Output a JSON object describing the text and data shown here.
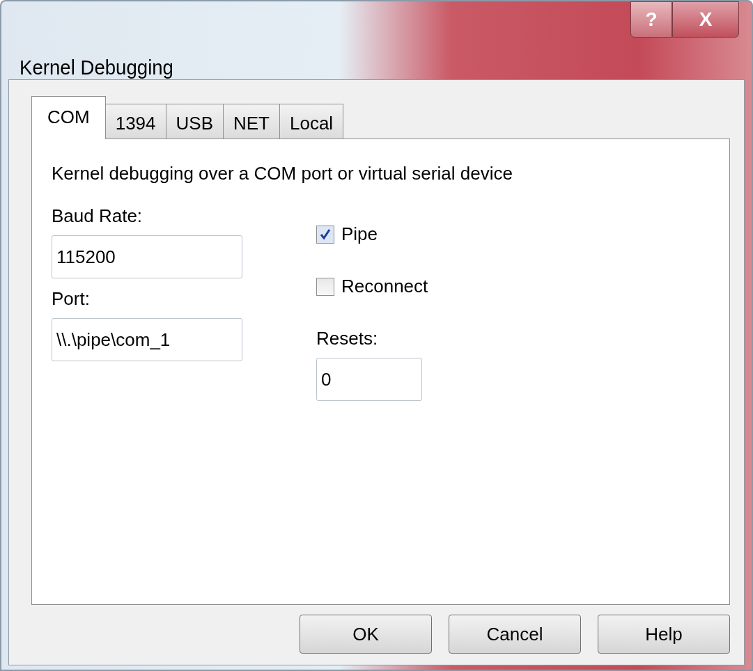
{
  "window": {
    "title": "Kernel Debugging",
    "title_buttons": [
      "?",
      "X"
    ]
  },
  "tabs": [
    {
      "label": "COM",
      "selected": true
    },
    {
      "label": "1394",
      "selected": false
    },
    {
      "label": "USB",
      "selected": false
    },
    {
      "label": "NET",
      "selected": false
    },
    {
      "label": "Local",
      "selected": false
    }
  ],
  "description": "Kernel debugging over a COM port or virtual serial device",
  "baud_rate": {
    "label": "Baud Rate:",
    "value": "115200"
  },
  "port": {
    "label": "Port:",
    "value": "\\\\.\\pipe\\com_1"
  },
  "options": [
    {
      "label": "Pipe",
      "checked": true
    },
    {
      "label": "Reconnect",
      "checked": false
    }
  ],
  "resets": {
    "label": "Resets:",
    "value": "0"
  },
  "buttons": [
    "OK",
    "Cancel",
    "Help"
  ]
}
